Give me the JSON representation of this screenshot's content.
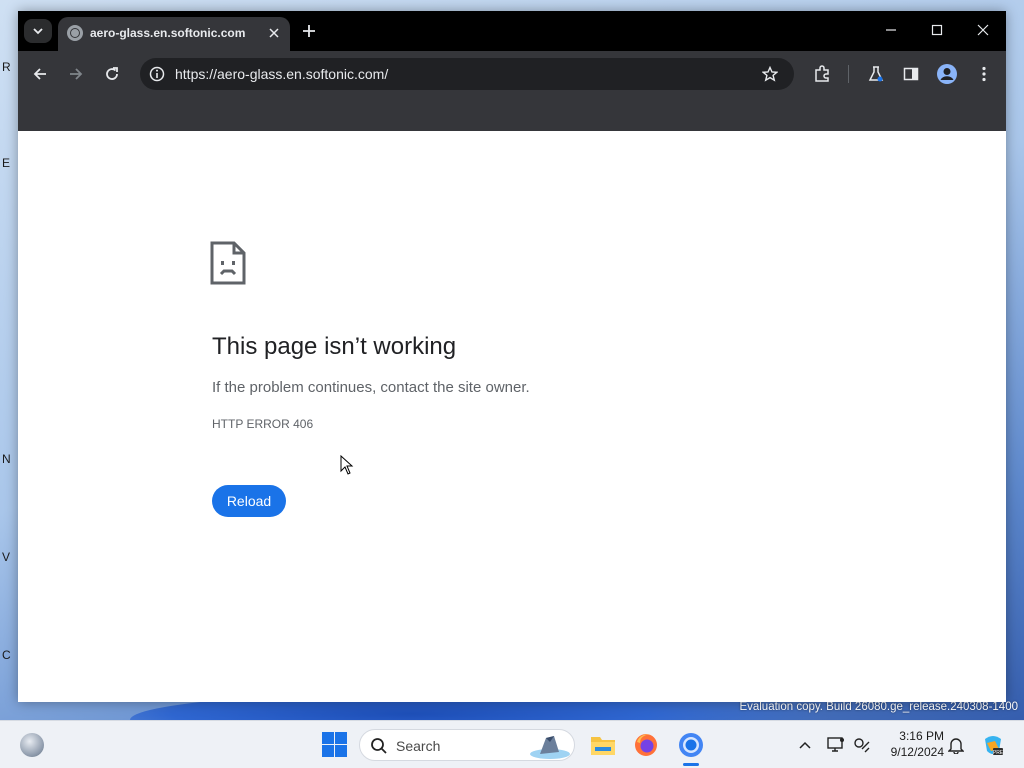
{
  "browser": {
    "tab_title": "aero-glass.en.softonic.com",
    "url": "https://aero-glass.en.softonic.com/"
  },
  "error_page": {
    "heading": "This page isn’t working",
    "message": "If the problem continues, contact the site owner.",
    "code": "HTTP ERROR 406",
    "reload_label": "Reload"
  },
  "taskbar": {
    "search_placeholder": "Search",
    "time": "3:16 PM",
    "date": "9/12/2024"
  },
  "desktop": {
    "watermark": "Evaluation copy. Build 26080.ge_release.240308-1400"
  },
  "colors": {
    "accent": "#1a73e8",
    "toolbar": "#35363a",
    "tabstrip": "#000000"
  },
  "icons": [
    "tab-search-icon",
    "globe-icon",
    "close-icon",
    "plus-icon",
    "minimize-icon",
    "maximize-icon",
    "back-arrow-icon",
    "forward-arrow-icon",
    "reload-icon",
    "info-icon",
    "star-icon",
    "extensions-icon",
    "labs-icon",
    "side-panel-icon",
    "profile-icon",
    "menu-dots-icon",
    "sad-document-icon",
    "windows-start-icon",
    "search-icon",
    "file-explorer-icon",
    "firefox-icon",
    "chrome-icon",
    "chevron-up-icon",
    "display-icon",
    "network-icon",
    "bell-icon",
    "copilot-icon"
  ]
}
